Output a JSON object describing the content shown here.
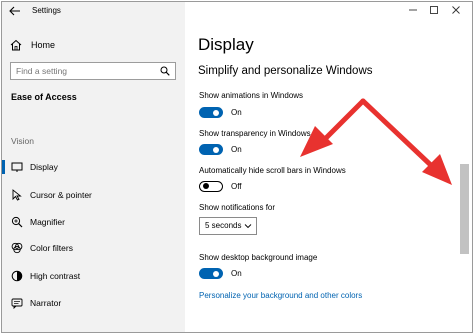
{
  "window": {
    "title": "Settings",
    "controls": [
      "minimize",
      "maximize",
      "close"
    ]
  },
  "sidebar": {
    "home_label": "Home",
    "search_placeholder": "Find a setting",
    "section_header": "Ease of Access",
    "group_label": "Vision",
    "items": [
      {
        "label": "Display",
        "icon": "monitor-icon",
        "active": true
      },
      {
        "label": "Cursor & pointer",
        "icon": "cursor-icon",
        "active": false
      },
      {
        "label": "Magnifier",
        "icon": "magnifier-icon",
        "active": false
      },
      {
        "label": "Color filters",
        "icon": "color-filters-icon",
        "active": false
      },
      {
        "label": "High contrast",
        "icon": "high-contrast-icon",
        "active": false
      },
      {
        "label": "Narrator",
        "icon": "narrator-icon",
        "active": false
      }
    ]
  },
  "main": {
    "page_title": "Display",
    "subtitle": "Simplify and personalize Windows",
    "settings": {
      "animations": {
        "label": "Show animations in Windows",
        "state": "On",
        "on": true
      },
      "transparency": {
        "label": "Show transparency in Windows",
        "state": "On",
        "on": true
      },
      "scrollbars": {
        "label": "Automatically hide scroll bars in Windows",
        "state": "Off",
        "on": false
      },
      "notifications": {
        "label": "Show notifications for",
        "value": "5 seconds"
      },
      "desktop_background": {
        "label": "Show desktop background image",
        "state": "On",
        "on": true
      }
    },
    "link": "Personalize your background and other colors"
  },
  "colors": {
    "accent": "#0063b1",
    "annotation_arrow": "#e8322f",
    "sidebar_bg": "#f2f2f2"
  }
}
